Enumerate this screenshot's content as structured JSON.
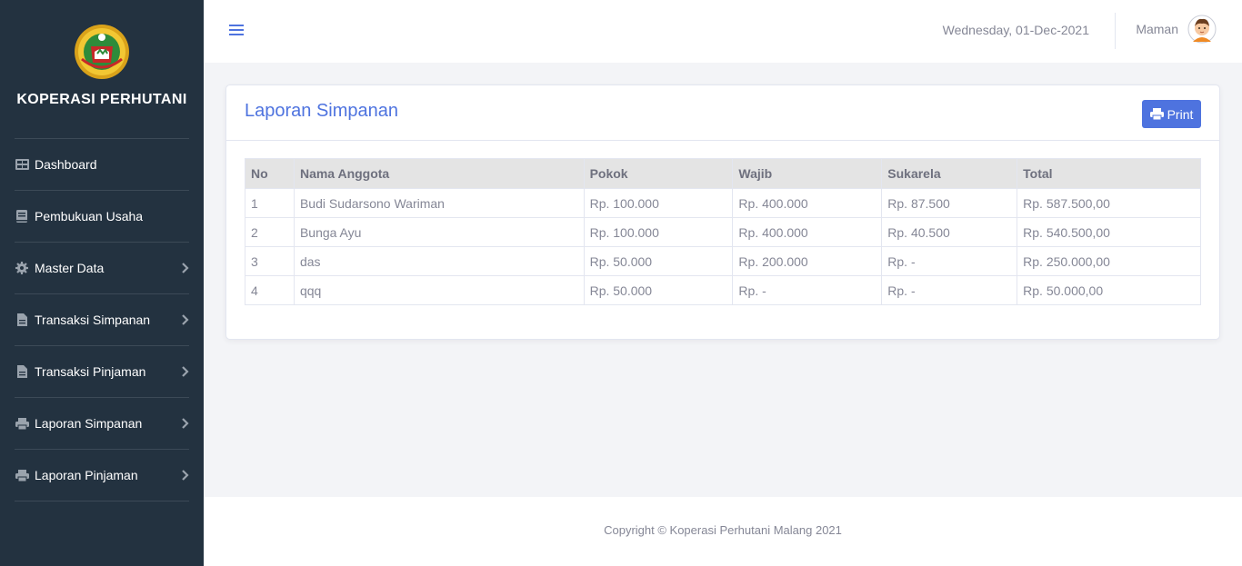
{
  "sidebar": {
    "brand": "KOPERASI PERHUTANI",
    "items": [
      {
        "label": "Dashboard",
        "icon": "table-icon",
        "has_arrow": false
      },
      {
        "label": "Pembukuan Usaha",
        "icon": "book-icon",
        "has_arrow": false
      },
      {
        "label": "Master Data",
        "icon": "gear-icon",
        "has_arrow": true
      },
      {
        "label": "Transaksi Simpanan",
        "icon": "file-icon",
        "has_arrow": true
      },
      {
        "label": "Transaksi Pinjaman",
        "icon": "file-icon",
        "has_arrow": true
      },
      {
        "label": "Laporan Simpanan",
        "icon": "printer-icon",
        "has_arrow": true
      },
      {
        "label": "Laporan Pinjaman",
        "icon": "printer-icon",
        "has_arrow": true
      }
    ]
  },
  "topbar": {
    "date": "Wednesday, 01-Dec-2021",
    "user_name": "Maman"
  },
  "card": {
    "title": "Laporan Simpanan",
    "print_label": "Print"
  },
  "table": {
    "headers": [
      "No",
      "Nama Anggota",
      "Pokok",
      "Wajib",
      "Sukarela",
      "Total"
    ],
    "rows": [
      [
        "1",
        "Budi Sudarsono Wariman",
        "Rp. 100.000",
        "Rp. 400.000",
        "Rp. 87.500",
        "Rp. 587.500,00"
      ],
      [
        "2",
        "Bunga Ayu",
        "Rp. 100.000",
        "Rp. 400.000",
        "Rp. 40.500",
        "Rp. 540.500,00"
      ],
      [
        "3",
        "das",
        "Rp. 50.000",
        "Rp. 200.000",
        "Rp. -",
        "Rp. 250.000,00"
      ],
      [
        "4",
        "qqq",
        "Rp. 50.000",
        "Rp. -",
        "Rp. -",
        "Rp. 50.000,00"
      ]
    ]
  },
  "footer": {
    "text": "Copyright © Koperasi Perhutani Malang 2021"
  },
  "colors": {
    "sidebar_bg": "#233240",
    "accent": "#4e73df",
    "text_muted": "#858796"
  }
}
